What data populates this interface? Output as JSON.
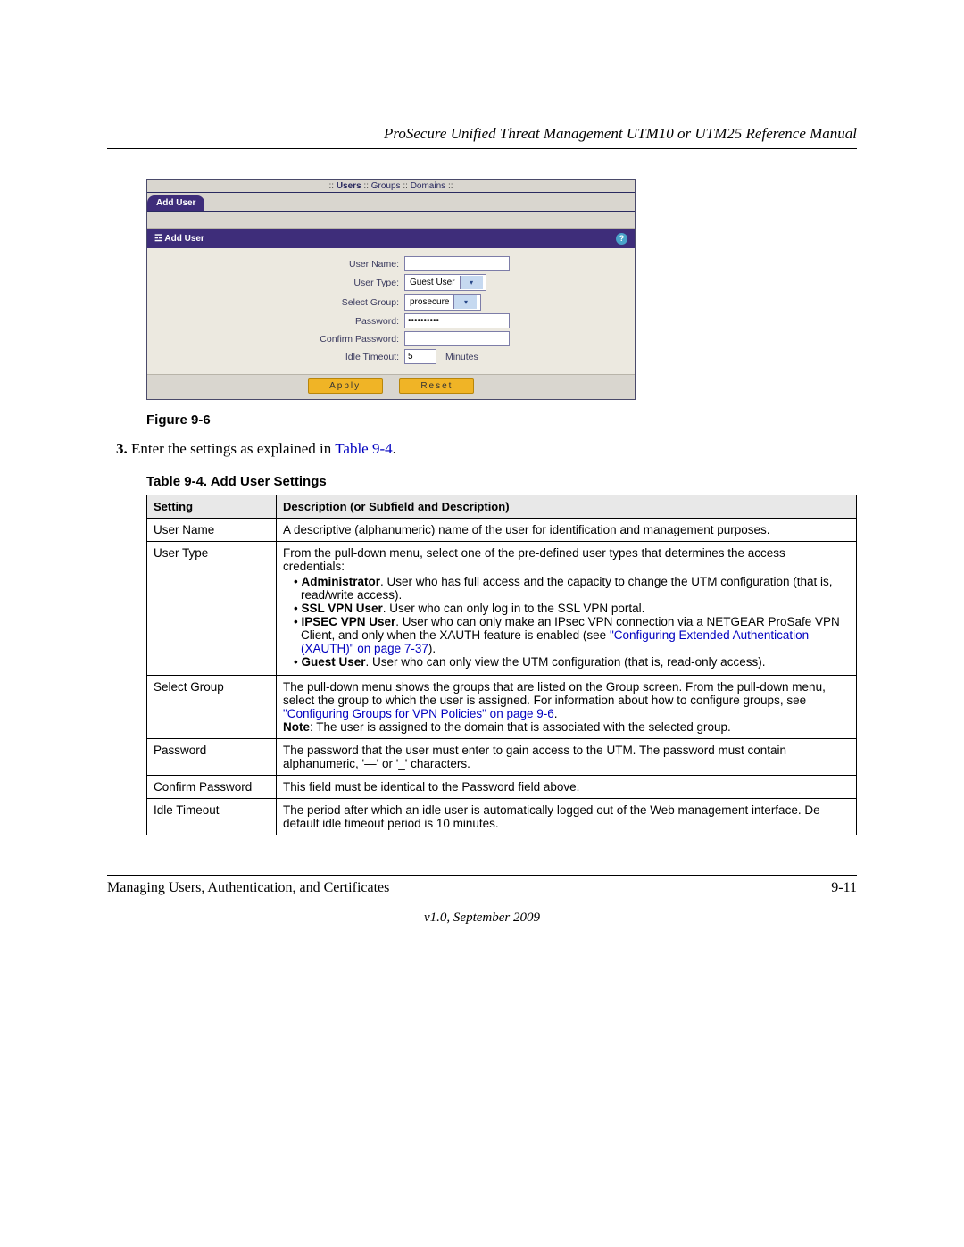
{
  "header": {
    "title": "ProSecure Unified Threat Management UTM10 or UTM25 Reference Manual"
  },
  "screenshot": {
    "crumbs": {
      "users": "Users",
      "groups": "Groups",
      "domains": "Domains"
    },
    "tab_label": "Add User",
    "panel_title": "Add User",
    "help_glyph": "?",
    "fields": {
      "username_label": "User Name:",
      "username_value": "",
      "usertype_label": "User Type:",
      "usertype_value": "Guest User",
      "group_label": "Select Group:",
      "group_value": "prosecure",
      "password_label": "Password:",
      "password_value": "••••••••••",
      "confirm_label": "Confirm Password:",
      "confirm_value": "",
      "idle_label": "Idle Timeout:",
      "idle_value": "5",
      "idle_unit": "Minutes"
    },
    "buttons": {
      "apply": "Apply",
      "reset": "Reset"
    }
  },
  "figure_caption": "Figure 9-6",
  "step": {
    "num": "3.",
    "text_before": "Enter the settings as explained in ",
    "link": "Table 9-4",
    "text_after": "."
  },
  "table_caption": "Table 9-4. Add User Settings",
  "table": {
    "headers": {
      "setting": "Setting",
      "desc": "Description (or Subfield and Description)"
    },
    "rows": [
      {
        "setting": "User Name",
        "desc": "A descriptive (alphanumeric) name of the user for identification and management purposes."
      },
      {
        "setting": "User Type",
        "desc_intro": "From the pull-down menu, select one of the pre-defined user types that determines the access credentials:",
        "bullets": [
          {
            "bold": "Administrator",
            "tail": ". User who has full access and the capacity to change the UTM configuration (that is, read/write access)."
          },
          {
            "bold": "SSL VPN User",
            "tail": ". User who can only log in to the SSL VPN portal."
          },
          {
            "bold": "IPSEC VPN User",
            "tail": ". User who can only make an IPsec VPN connection via a NETGEAR ProSafe VPN Client, and only when the XAUTH feature is enabled (see ",
            "link": "\"Configuring Extended Authentication (XAUTH)\" on page 7-37",
            "tail2": ")."
          },
          {
            "bold": "Guest User",
            "tail": ". User who can only view the UTM configuration (that is, read-only access)."
          }
        ]
      },
      {
        "setting": "Select Group",
        "desc_before": "The pull-down menu shows the groups that are listed on the Group screen. From the pull-down menu, select the group to which the user is assigned. For information about how to configure groups, see ",
        "link": "\"Configuring Groups for VPN Policies\" on page 9-6",
        "desc_after": ".",
        "note_label": "Note",
        "note_text": ": The user is assigned to the domain that is associated with the selected group."
      },
      {
        "setting": "Password",
        "desc": "The password that the user must enter to gain access to the UTM. The password must contain alphanumeric, '—' or '_' characters."
      },
      {
        "setting": "Confirm Password",
        "desc": "This field must be identical to the Password field above."
      },
      {
        "setting": "Idle Timeout",
        "desc": "The period after which an idle user is automatically logged out of the Web management interface. De default idle timeout period is 10 minutes."
      }
    ]
  },
  "footer": {
    "left": "Managing Users, Authentication, and Certificates",
    "right": "9-11",
    "version": "v1.0, September 2009"
  }
}
